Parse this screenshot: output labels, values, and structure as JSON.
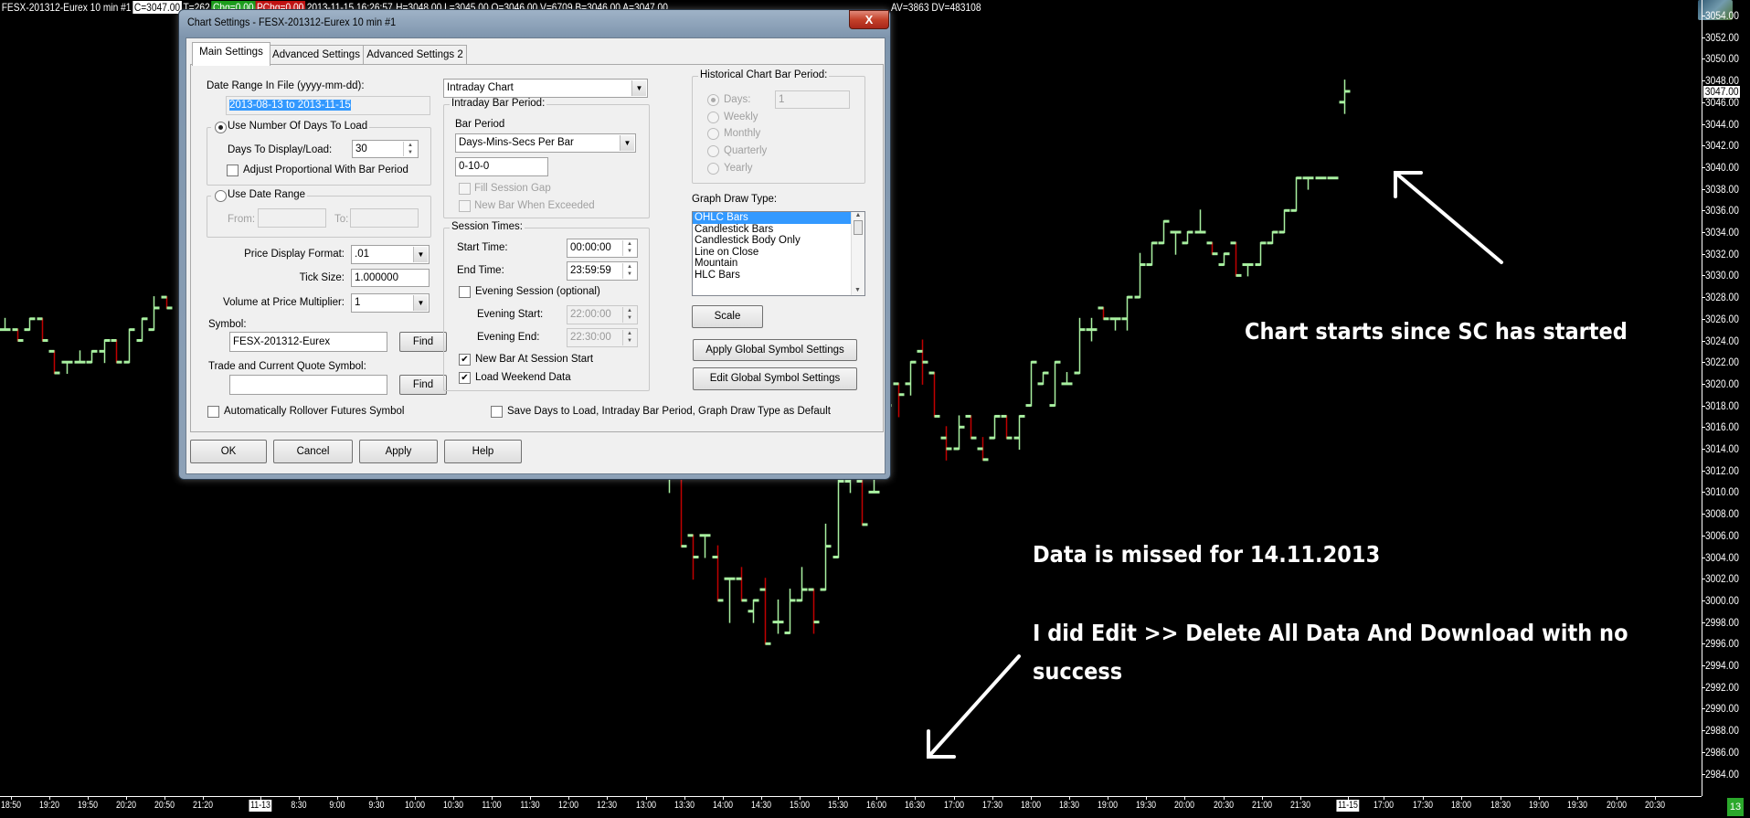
{
  "header": {
    "symbol_title": "FESX-201312-Eurex  10 min  #1",
    "close": "C=3047.00",
    "trades": "T=262",
    "change": "Chg=0.00",
    "pchange": "PChg=0.00",
    "datetime": "2013-11-15 16:26:57",
    "stats": "H=3048.00 L=3045.00 O=3046.00 V=6709 B=3046.00 A=3047.00",
    "tail": "AV=3863 DV=483108"
  },
  "colors": {
    "up": "#a8f0a0",
    "down": "#c00000",
    "background": "#000000",
    "selection": "#3399ff"
  },
  "price_axis": {
    "labels": [
      "3054.00",
      "3052.00",
      "3050.00",
      "3048.00",
      "3046.00",
      "3044.00",
      "3042.00",
      "3040.00",
      "3038.00",
      "3036.00",
      "3034.00",
      "3032.00",
      "3030.00",
      "3028.00",
      "3026.00",
      "3024.00",
      "3022.00",
      "3020.00",
      "3018.00",
      "3016.00",
      "3014.00",
      "3012.00",
      "3010.00",
      "3008.00",
      "3006.00",
      "3004.00",
      "3002.00",
      "3000.00",
      "2998.00",
      "2996.00",
      "2994.00",
      "2992.00",
      "2990.00",
      "2988.00",
      "2986.00",
      "2984.00"
    ],
    "current_price": "3047.00"
  },
  "time_axis": {
    "left_labels": [
      "18:50",
      "19:20",
      "19:50",
      "20:20",
      "20:50",
      "21:20"
    ],
    "day1": "11-13",
    "mid_labels": [
      "8:30",
      "9:00",
      "9:30",
      "10:00",
      "10:30",
      "11:00",
      "11:30",
      "12:00",
      "12:30",
      "13:00",
      "13:30",
      "14:00",
      "14:30",
      "15:00",
      "15:30",
      "16:00",
      "16:30",
      "17:00",
      "17:30",
      "18:00",
      "18:30",
      "19:00",
      "19:30",
      "20:00",
      "20:30",
      "21:00",
      "21:30"
    ],
    "day2": "11-15",
    "right_labels": [
      "17:00",
      "17:30",
      "18:00",
      "18:30",
      "19:00",
      "19:30",
      "20:00",
      "20:30"
    ],
    "corner_badge": "13"
  },
  "chart_data": {
    "type": "ohlc",
    "ylim": [
      2983,
      3055
    ],
    "bars_format": [
      "slot",
      "open",
      "high",
      "low",
      "close"
    ],
    "bars": [
      [
        0,
        3025,
        3026,
        3025,
        3025
      ],
      [
        1,
        3025,
        3025,
        3024,
        3024
      ],
      [
        2,
        3025,
        3026,
        3025,
        3026
      ],
      [
        3,
        3026,
        3026,
        3024,
        3024
      ],
      [
        4,
        3023,
        3023,
        3021,
        3021
      ],
      [
        5,
        3022,
        3022,
        3021,
        3022
      ],
      [
        6,
        3022,
        3023,
        3022,
        3022
      ],
      [
        7,
        3022,
        3023,
        3022,
        3023
      ],
      [
        8,
        3023,
        3024,
        3022,
        3024
      ],
      [
        9,
        3024,
        3024,
        3022,
        3022
      ],
      [
        10,
        3022,
        3025,
        3022,
        3025
      ],
      [
        11,
        3024,
        3026,
        3024,
        3026
      ],
      [
        12,
        3025,
        3028,
        3025,
        3027
      ],
      [
        13,
        3028,
        3028,
        3027,
        3027
      ],
      [
        51,
        3012,
        3013,
        3010,
        3012
      ],
      [
        52,
        3012,
        3012,
        3005,
        3005
      ],
      [
        53,
        3006,
        3006,
        3002,
        3004
      ],
      [
        54,
        3006,
        3006,
        3004,
        3006
      ],
      [
        55,
        3004,
        3005,
        3000,
        3000
      ],
      [
        56,
        3002,
        3002,
        2998,
        3002
      ],
      [
        57,
        3002,
        3003,
        3000,
        3000
      ],
      [
        58,
        2999,
        3000,
        2998,
        3000
      ],
      [
        59,
        3001,
        3002,
        2996,
        2996
      ],
      [
        60,
        2998,
        3000,
        2997,
        2998
      ],
      [
        61,
        2997,
        3001,
        2997,
        3000
      ],
      [
        62,
        3000,
        3003,
        3000,
        3001
      ],
      [
        63,
        3001,
        3001,
        2997,
        2998
      ],
      [
        64,
        3001,
        3007,
        3001,
        3005
      ],
      [
        65,
        3004,
        3012,
        3004,
        3011
      ],
      [
        66,
        3011,
        3013,
        3010,
        3012
      ],
      [
        67,
        3011,
        3012,
        3007,
        3007
      ],
      [
        68,
        3010,
        3012,
        3010,
        3010
      ],
      [
        69,
        3015,
        3019,
        3013,
        3018
      ],
      [
        70,
        3020,
        3020,
        3017,
        3019
      ],
      [
        71,
        3020,
        3022,
        3019,
        3022
      ],
      [
        72,
        3023,
        3024,
        3020,
        3022
      ],
      [
        73,
        3021,
        3021,
        3017,
        3017
      ],
      [
        74,
        3015,
        3016,
        3013,
        3014
      ],
      [
        75,
        3014,
        3017,
        3014,
        3016
      ],
      [
        76,
        3017,
        3017,
        3015,
        3015
      ],
      [
        77,
        3014,
        3015,
        3013,
        3013
      ],
      [
        78,
        3015,
        3017,
        3015,
        3017
      ],
      [
        79,
        3017,
        3017,
        3015,
        3015
      ],
      [
        80,
        3015,
        3017,
        3014,
        3017
      ],
      [
        81,
        3018,
        3022,
        3018,
        3022
      ],
      [
        82,
        3020,
        3021,
        3020,
        3021
      ],
      [
        83,
        3018,
        3022,
        3018,
        3022
      ],
      [
        84,
        3020,
        3021,
        3020,
        3020
      ],
      [
        85,
        3021,
        3026,
        3021,
        3025
      ],
      [
        86,
        3025,
        3026,
        3024,
        3025
      ],
      [
        87,
        3027,
        3027,
        3026,
        3026
      ],
      [
        88,
        3026,
        3026,
        3025,
        3026
      ],
      [
        89,
        3026,
        3028,
        3025,
        3028
      ],
      [
        90,
        3028,
        3032,
        3028,
        3031
      ],
      [
        91,
        3031,
        3033,
        3031,
        3033
      ],
      [
        92,
        3033,
        3035,
        3033,
        3035
      ],
      [
        93,
        3034,
        3034,
        3032,
        3034
      ],
      [
        94,
        3033,
        3034,
        3033,
        3034
      ],
      [
        95,
        3034,
        3036,
        3034,
        3034
      ],
      [
        96,
        3033,
        3033,
        3032,
        3032
      ],
      [
        97,
        3031,
        3032,
        3031,
        3032
      ],
      [
        98,
        3033,
        3033,
        3030,
        3030
      ],
      [
        99,
        3031,
        3031,
        3030,
        3031
      ],
      [
        100,
        3031,
        3033,
        3031,
        3033
      ],
      [
        101,
        3033,
        3034,
        3033,
        3034
      ],
      [
        102,
        3034,
        3036,
        3034,
        3036
      ],
      [
        103,
        3036,
        3039,
        3036,
        3039
      ],
      [
        104,
        3039,
        3039,
        3038,
        3039
      ],
      [
        105,
        3039,
        3039,
        3039,
        3039
      ],
      [
        106,
        3039,
        3039,
        3039,
        3039
      ],
      [
        107,
        3046,
        3048,
        3045,
        3047
      ]
    ]
  },
  "annotations": {
    "note1": "Chart starts since SC has started",
    "note2": "Data is missed for 14.11.2013",
    "note3_line1": "I did Edit >> Delete All Data And Download with no",
    "note3_line2": "success"
  },
  "dialog": {
    "title": "Chart Settings - FESX-201312-Eurex  10 min  #1",
    "close_label": "X",
    "tabs": [
      "Main Settings",
      "Advanced Settings",
      "Advanced Settings 2"
    ],
    "date_range_label": "Date Range In File (yyyy-mm-dd):",
    "date_range_value": "2013-08-13 to 2013-11-15",
    "use_days_label": "Use Number Of Days To Load",
    "days_label": "Days To Display/Load:",
    "days_value": "30",
    "adjust_label": "Adjust Proportional With Bar Period",
    "use_date_range_label": "Use Date Range",
    "from_label": "From:",
    "to_label": "To:",
    "price_format_label": "Price Display Format:",
    "price_format_value": ".01",
    "tick_size_label": "Tick Size:",
    "tick_size_value": "1.000000",
    "vap_label": "Volume at Price Multiplier:",
    "vap_value": "1",
    "symbol_label": "Symbol:",
    "symbol_value": "FESX-201312-Eurex",
    "find_label": "Find",
    "trade_symbol_label": "Trade and Current Quote Symbol:",
    "trade_symbol_value": "",
    "rollover_label": "Automatically Rollover Futures Symbol",
    "chart_type_value": "Intraday Chart",
    "intraday_group": "Intraday Bar Period:",
    "bar_period_label": "Bar Period",
    "bar_period_type": "Days-Mins-Secs Per Bar",
    "bar_period_value": "0-10-0",
    "fill_gap_label": "Fill Session Gap",
    "new_bar_exceeded_label": "New Bar When Exceeded",
    "session_group": "Session Times:",
    "start_time_label": "Start Time:",
    "start_time_value": "00:00:00",
    "end_time_label": "End Time:",
    "end_time_value": "23:59:59",
    "evening_session_label": "Evening Session (optional)",
    "evening_start_label": "Evening Start:",
    "evening_start_value": "22:00:00",
    "evening_end_label": "Evening End:",
    "evening_end_value": "22:30:00",
    "new_bar_session_label": "New Bar At Session Start",
    "load_weekend_label": "Load Weekend Data",
    "save_default_label": "Save Days to Load, Intraday Bar Period, Graph Draw Type as Default",
    "historical_group": "Historical Chart Bar Period:",
    "hist_days_label": "Days:",
    "hist_days_value": "1",
    "hist_weekly": "Weekly",
    "hist_monthly": "Monthly",
    "hist_quarterly": "Quarterly",
    "hist_yearly": "Yearly",
    "graph_draw_label": "Graph Draw Type:",
    "graph_draw_types": [
      "OHLC Bars",
      "Candlestick Bars",
      "Candlestick Body Only",
      "Line on Close",
      "Mountain",
      "HLC Bars"
    ],
    "scale_label": "Scale",
    "apply_global_label": "Apply Global Symbol Settings",
    "edit_global_label": "Edit Global Symbol Settings",
    "ok_label": "OK",
    "cancel_label": "Cancel",
    "apply_label": "Apply",
    "help_label": "Help"
  }
}
